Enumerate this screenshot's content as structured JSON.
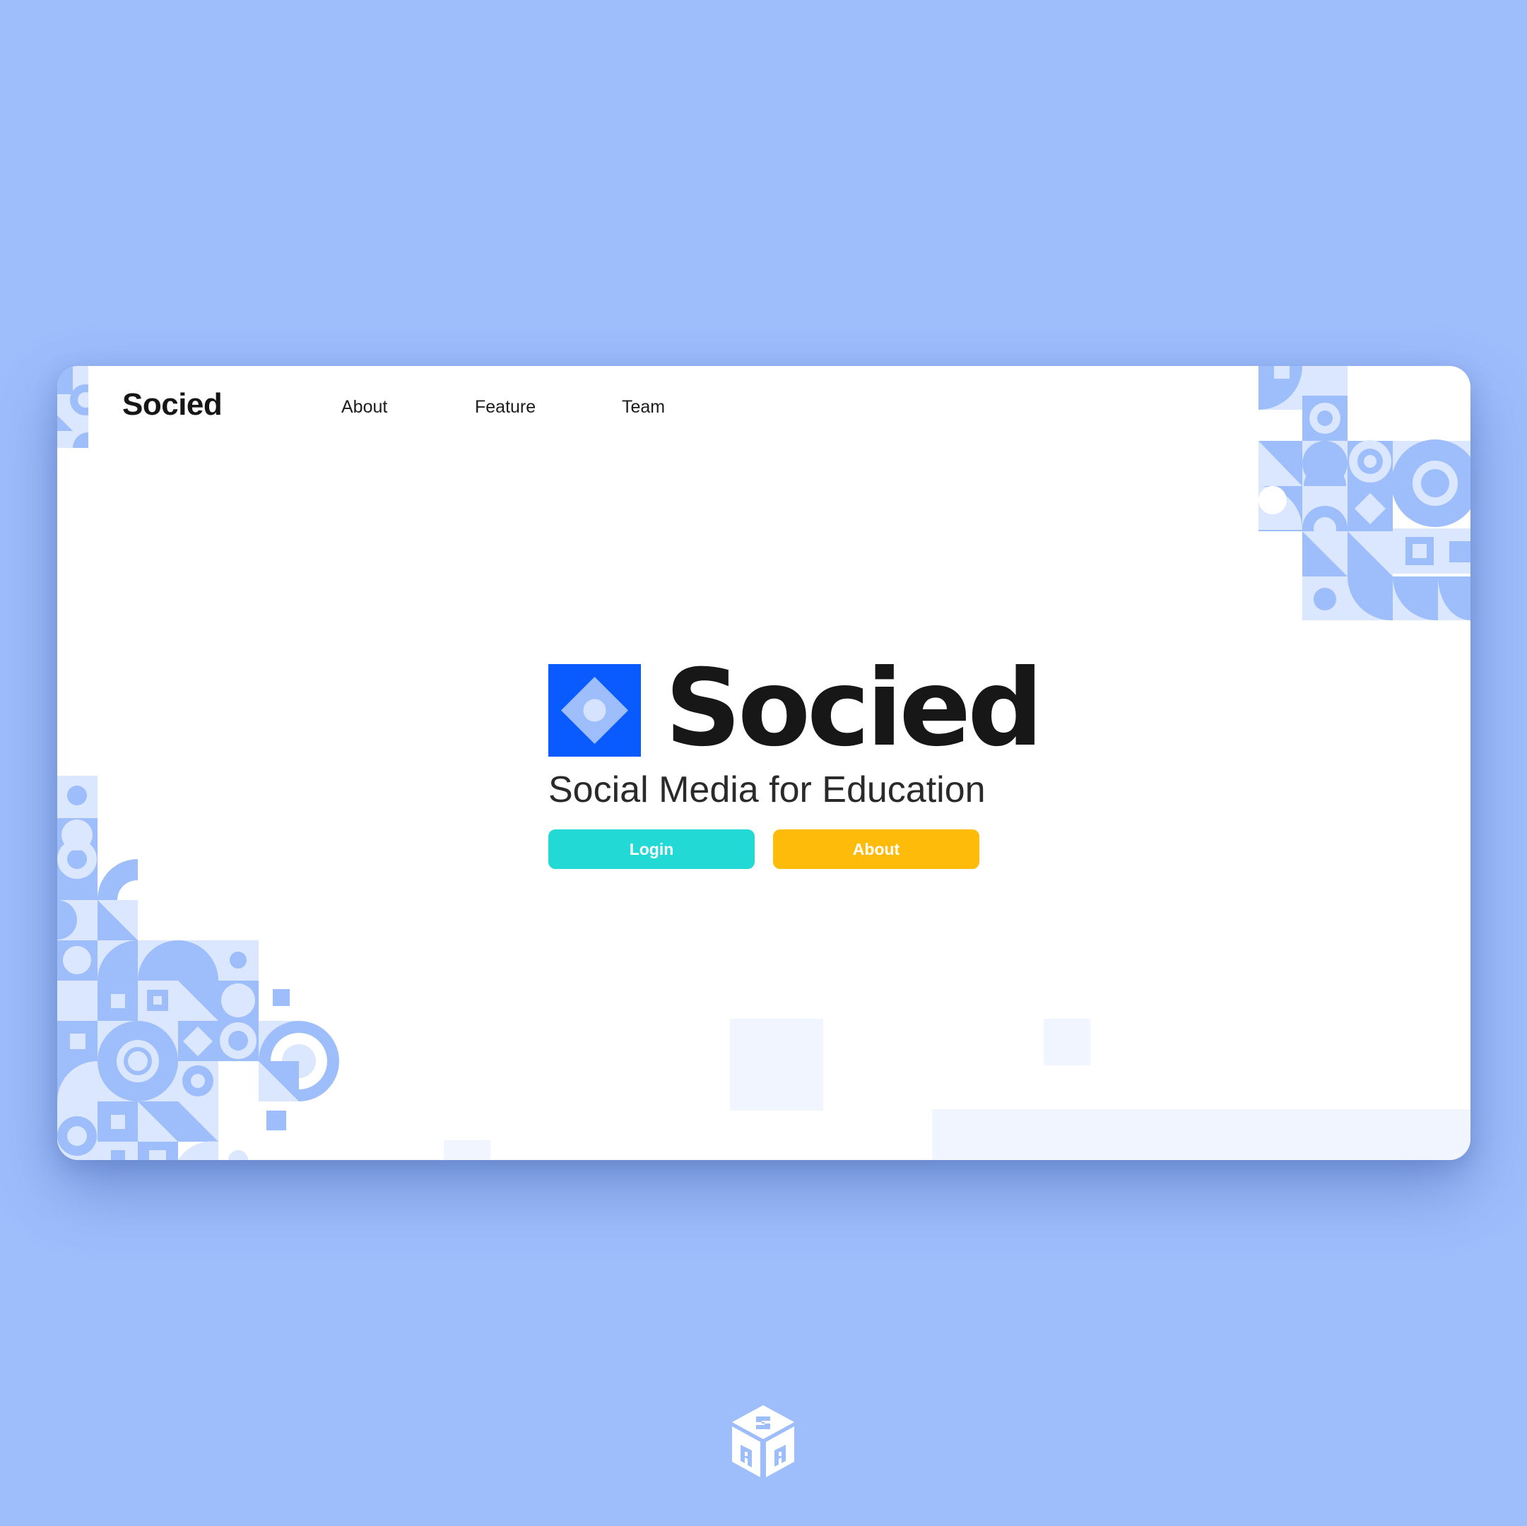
{
  "nav": {
    "brand": "Socied",
    "links": [
      "About",
      "Feature",
      "Team"
    ]
  },
  "hero": {
    "title": "Socied",
    "tagline": "Social Media for Education",
    "login_label": "Login",
    "about_label": "About"
  },
  "colors": {
    "page_background": "#9ebdfb",
    "logo_blue": "#0a5bff",
    "login_teal": "#23d9d6",
    "about_yellow": "#ffbb0a",
    "pattern_blue": "#9ebdfb",
    "pattern_light": "#dbe7ff"
  },
  "icons": {
    "brand_logo": "diamond-in-square-icon",
    "watermark": "isometric-cube-logo-icon"
  }
}
